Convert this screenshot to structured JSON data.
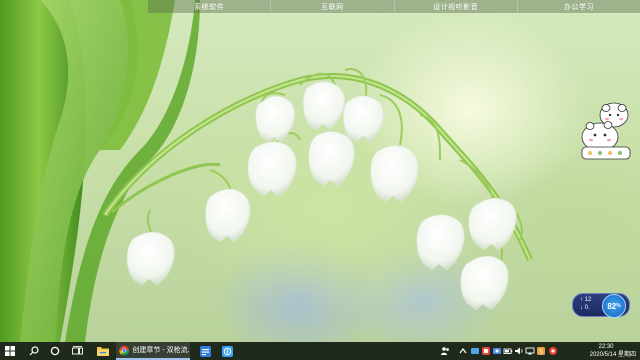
{
  "top_bar": {
    "items": [
      {
        "label": "系统软件"
      },
      {
        "label": "互联网"
      },
      {
        "label": "设计视听影音"
      },
      {
        "label": "办公学习"
      }
    ]
  },
  "widgets": {
    "net": {
      "upload": "↑ 12",
      "download": "↓ 0.",
      "percent": "82",
      "percent_unit": "%"
    }
  },
  "taskbar": {
    "start_icon": "windows-logo-icon",
    "search_icon": "search-icon",
    "cortana_icon": "cortana-circle-icon",
    "taskview_icon": "task-view-icon",
    "apps": [
      {
        "name": "file-explorer",
        "icon": "folder-icon"
      },
      {
        "name": "chrome",
        "icon": "chrome-icon",
        "label": "创建章节 - 双枪流..."
      },
      {
        "name": "app-blue",
        "icon": "blue-app-icon"
      },
      {
        "name": "app-compass",
        "icon": "compass-icon"
      }
    ],
    "clock": {
      "time": "22:30",
      "date": "2020/5/14 星期四"
    }
  },
  "colors": {
    "taskbar": "#1f2a1d",
    "accent": "#9fc3ee"
  }
}
